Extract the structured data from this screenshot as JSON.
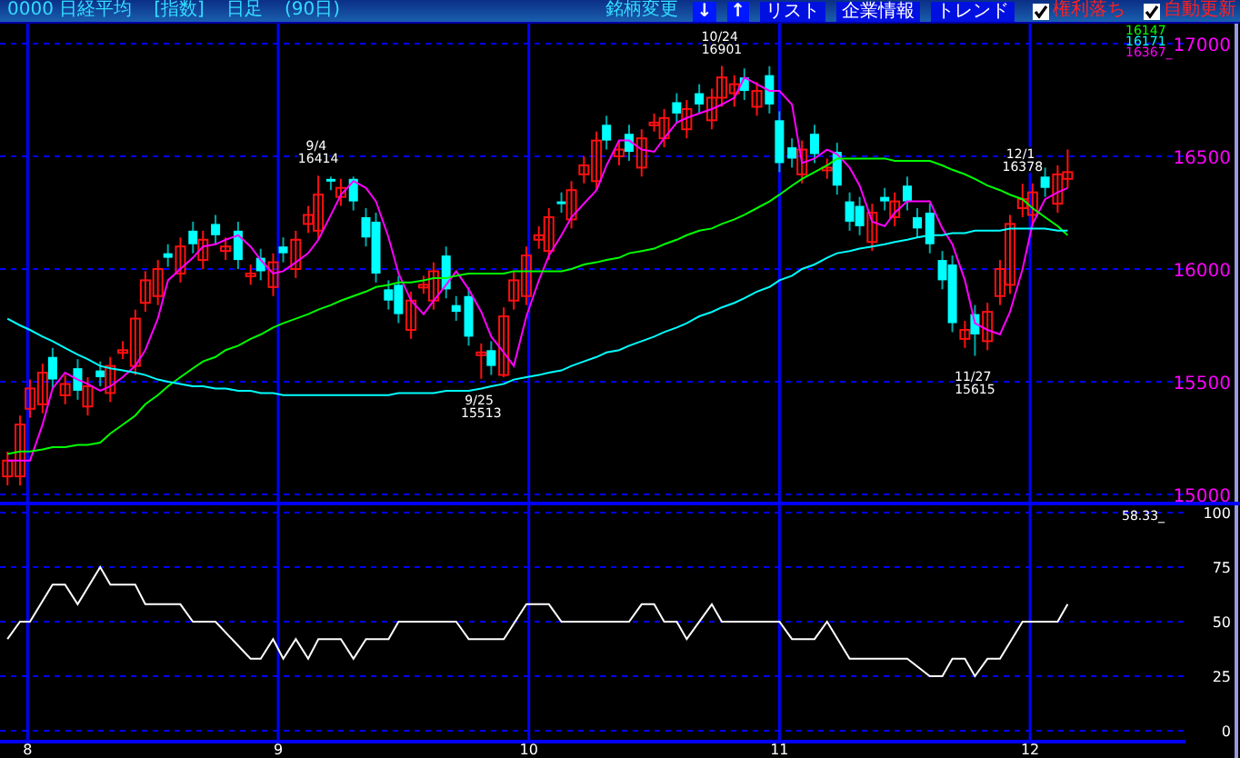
{
  "header": {
    "code": "0000",
    "name": "日経平均",
    "type": "[指数]",
    "period": "日足",
    "span": "(90日)"
  },
  "toolbar": {
    "label": "銘柄変更",
    "buttons": [
      {
        "kind": "arrow",
        "label": "↓"
      },
      {
        "kind": "arrow",
        "label": "↑"
      },
      {
        "kind": "text",
        "label": "リスト"
      },
      {
        "kind": "text",
        "label": "企業情報"
      },
      {
        "kind": "text",
        "label": "トレンド"
      }
    ],
    "options": [
      {
        "label": "権利落ち",
        "checked": true
      },
      {
        "label": "自動更新",
        "checked": true
      }
    ]
  },
  "price_chart": {
    "ma_values": [
      {
        "text": "16147",
        "color": "#00ff00"
      },
      {
        "text": "16171",
        "color": "#00ffff"
      },
      {
        "text": "16367_",
        "color": "#ff00ff"
      }
    ],
    "chart_data": {
      "type": "candlestick",
      "xlim": [
        7.89,
        12.62
      ],
      "ylim": [
        15000,
        17000
      ],
      "yticks": [
        15000,
        15500,
        16000,
        16500,
        17000
      ],
      "grid": true,
      "x": [
        7.92,
        7.97,
        8.01,
        8.06,
        8.1,
        8.15,
        8.2,
        8.24,
        8.29,
        8.33,
        8.38,
        8.43,
        8.47,
        8.52,
        8.56,
        8.61,
        8.66,
        8.7,
        8.75,
        8.79,
        8.84,
        8.89,
        8.93,
        8.98,
        9.02,
        9.07,
        9.12,
        9.16,
        9.21,
        9.25,
        9.3,
        9.35,
        9.39,
        9.44,
        9.48,
        9.53,
        9.58,
        9.62,
        9.67,
        9.71,
        9.76,
        9.81,
        9.85,
        9.9,
        9.94,
        9.99,
        10.04,
        10.08,
        10.13,
        10.17,
        10.22,
        10.27,
        10.31,
        10.36,
        10.4,
        10.45,
        10.5,
        10.54,
        10.59,
        10.63,
        10.68,
        10.73,
        10.77,
        10.82,
        10.86,
        10.91,
        10.96,
        11,
        11.05,
        11.09,
        11.14,
        11.19,
        11.23,
        11.28,
        11.32,
        11.37,
        11.42,
        11.46,
        11.51,
        11.55,
        11.6,
        11.65,
        11.69,
        11.74,
        11.78,
        11.83,
        11.88,
        11.92,
        11.97,
        12.01,
        12.06,
        12.11,
        12.15
      ],
      "ohlc": [
        [
          15080,
          15190,
          15040,
          15150
        ],
        [
          15080,
          15350,
          15040,
          15310
        ],
        [
          15380,
          15510,
          15340,
          15470
        ],
        [
          15400,
          15580,
          15360,
          15540
        ],
        [
          15610,
          15650,
          15470,
          15510
        ],
        [
          15440,
          15530,
          15400,
          15490
        ],
        [
          15560,
          15600,
          15420,
          15460
        ],
        [
          15390,
          15520,
          15350,
          15480
        ],
        [
          15550,
          15590,
          15480,
          15520
        ],
        [
          15450,
          15610,
          15410,
          15570
        ],
        [
          15640,
          15680,
          15600,
          15640
        ],
        [
          15570,
          15820,
          15530,
          15780
        ],
        [
          15850,
          15990,
          15810,
          15950
        ],
        [
          15880,
          16040,
          15840,
          16000
        ],
        [
          16070,
          16110,
          16010,
          16050
        ],
        [
          15980,
          16140,
          15940,
          16100
        ],
        [
          16170,
          16210,
          16070,
          16110
        ],
        [
          16040,
          16170,
          16000,
          16130
        ],
        [
          16200,
          16240,
          16110,
          16150
        ],
        [
          16080,
          16140,
          16040,
          16100
        ],
        [
          16170,
          16210,
          16000,
          16040
        ],
        [
          15970,
          16020,
          15930,
          15980
        ],
        [
          16050,
          16090,
          15950,
          15990
        ],
        [
          15920,
          16070,
          15880,
          16030
        ],
        [
          16100,
          16140,
          16030,
          16070
        ],
        [
          16000,
          16170,
          15960,
          16130
        ],
        [
          16200,
          16280,
          16160,
          16240
        ],
        [
          16170,
          16414,
          16130,
          16330
        ],
        [
          16400,
          16410,
          16350,
          16390
        ],
        [
          16320,
          16400,
          16280,
          16360
        ],
        [
          16400,
          16410,
          16260,
          16300
        ],
        [
          16230,
          16270,
          16100,
          16140
        ],
        [
          16210,
          16250,
          15940,
          15980
        ],
        [
          15910,
          15950,
          15820,
          15860
        ],
        [
          15930,
          15970,
          15760,
          15800
        ],
        [
          15730,
          15900,
          15690,
          15860
        ],
        [
          15930,
          15970,
          15890,
          15930
        ],
        [
          15860,
          16030,
          15820,
          15990
        ],
        [
          16060,
          16100,
          15870,
          15910
        ],
        [
          15840,
          15880,
          15770,
          15810
        ],
        [
          15880,
          15920,
          15660,
          15700
        ],
        [
          15630,
          15670,
          15513,
          15630
        ],
        [
          15640,
          15680,
          15530,
          15570
        ],
        [
          15530,
          15830,
          15520,
          15790
        ],
        [
          15860,
          15990,
          15820,
          15950
        ],
        [
          15880,
          16100,
          15840,
          16060
        ],
        [
          16130,
          16190,
          16090,
          16150
        ],
        [
          16080,
          16270,
          16040,
          16230
        ],
        [
          16300,
          16340,
          16250,
          16290
        ],
        [
          16220,
          16390,
          16180,
          16350
        ],
        [
          16420,
          16500,
          16380,
          16460
        ],
        [
          16390,
          16610,
          16350,
          16570
        ],
        [
          16640,
          16680,
          16530,
          16570
        ],
        [
          16500,
          16570,
          16460,
          16530
        ],
        [
          16600,
          16640,
          16480,
          16520
        ],
        [
          16450,
          16620,
          16410,
          16580
        ],
        [
          16650,
          16690,
          16610,
          16650
        ],
        [
          16580,
          16710,
          16540,
          16670
        ],
        [
          16740,
          16780,
          16650,
          16690
        ],
        [
          16620,
          16750,
          16580,
          16710
        ],
        [
          16780,
          16820,
          16690,
          16730
        ],
        [
          16660,
          16800,
          16620,
          16760
        ],
        [
          16760,
          16901,
          16720,
          16850
        ],
        [
          16780,
          16860,
          16720,
          16820
        ],
        [
          16850,
          16890,
          16750,
          16790
        ],
        [
          16720,
          16830,
          16680,
          16790
        ],
        [
          16860,
          16900,
          16690,
          16730
        ],
        [
          16660,
          16700,
          16430,
          16470
        ],
        [
          16540,
          16580,
          16450,
          16490
        ],
        [
          16420,
          16570,
          16380,
          16530
        ],
        [
          16600,
          16640,
          16470,
          16510
        ],
        [
          16440,
          16490,
          16400,
          16450
        ],
        [
          16520,
          16560,
          16330,
          16370
        ],
        [
          16300,
          16340,
          16170,
          16210
        ],
        [
          16280,
          16320,
          16150,
          16190
        ],
        [
          16120,
          16290,
          16080,
          16250
        ],
        [
          16320,
          16360,
          16260,
          16300
        ],
        [
          16230,
          16340,
          16190,
          16300
        ],
        [
          16370,
          16410,
          16260,
          16300
        ],
        [
          16230,
          16270,
          16140,
          16180
        ],
        [
          16250,
          16290,
          16070,
          16110
        ],
        [
          16040,
          16080,
          15910,
          15950
        ],
        [
          16020,
          16060,
          15720,
          15760
        ],
        [
          15690,
          15770,
          15650,
          15730
        ],
        [
          15800,
          15840,
          15615,
          15710
        ],
        [
          15680,
          15850,
          15640,
          15810
        ],
        [
          15880,
          16040,
          15840,
          16000
        ],
        [
          15930,
          16240,
          15890,
          16200
        ],
        [
          16270,
          16378,
          16230,
          16310
        ],
        [
          16240,
          16380,
          16200,
          16340
        ],
        [
          16410,
          16450,
          16320,
          16360
        ],
        [
          16290,
          16460,
          16250,
          16420
        ],
        [
          16400,
          16530,
          16360,
          16430
        ]
      ],
      "annotations": [
        {
          "x": 9.16,
          "y": 16414,
          "text": "9/4 16414"
        },
        {
          "x": 10.77,
          "y": 16901,
          "text": "10/24 16901"
        },
        {
          "x": 9.81,
          "y": 15513,
          "text": "9/25 15513"
        },
        {
          "x": 11.78,
          "y": 15615,
          "text": "11/27 15615"
        },
        {
          "x": 11.97,
          "y": 16378,
          "text": "12/1 16378"
        }
      ]
    },
    "moving_averages": {
      "chart_data": {
        "type": "line",
        "xlim": [
          7.89,
          12.62
        ],
        "ylim": [
          15000,
          17000
        ],
        "x": [
          7.92,
          7.97,
          8.01,
          8.06,
          8.1,
          8.15,
          8.2,
          8.24,
          8.29,
          8.33,
          8.38,
          8.43,
          8.47,
          8.52,
          8.56,
          8.61,
          8.66,
          8.7,
          8.75,
          8.79,
          8.84,
          8.89,
          8.93,
          8.98,
          9.02,
          9.07,
          9.12,
          9.16,
          9.21,
          9.25,
          9.3,
          9.35,
          9.39,
          9.44,
          9.48,
          9.53,
          9.58,
          9.62,
          9.67,
          9.71,
          9.76,
          9.81,
          9.85,
          9.9,
          9.94,
          9.99,
          10.04,
          10.08,
          10.13,
          10.17,
          10.22,
          10.27,
          10.31,
          10.36,
          10.4,
          10.45,
          10.5,
          10.54,
          10.59,
          10.63,
          10.68,
          10.73,
          10.77,
          10.82,
          10.86,
          10.91,
          10.96,
          11,
          11.05,
          11.09,
          11.14,
          11.19,
          11.23,
          11.28,
          11.32,
          11.37,
          11.42,
          11.46,
          11.51,
          11.55,
          11.6,
          11.65,
          11.69,
          11.74,
          11.78,
          11.83,
          11.88,
          11.92,
          11.97,
          12.01,
          12.06,
          12.11,
          12.15
        ],
        "series": [
          {
            "color": "#ff00ff",
            "values": [
              15150,
              15150,
              15150,
              15310,
              15470,
              15540,
              15510,
              15490,
              15460,
              15480,
              15520,
              15570,
              15640,
              15780,
              15950,
              16000,
              16050,
              16100,
              16110,
              16130,
              16150,
              16100,
              16040,
              15980,
              15990,
              16030,
              16070,
              16130,
              16240,
              16330,
              16390,
              16360,
              16300,
              16140,
              15980,
              15860,
              15800,
              15860,
              15930,
              15990,
              15910,
              15810,
              15700,
              15630,
              15570,
              15790,
              15950,
              16060,
              16150,
              16230,
              16290,
              16350,
              16460,
              16570,
              16570,
              16530,
              16520,
              16580,
              16650,
              16670,
              16690,
              16710,
              16730,
              16760,
              16850,
              16820,
              16790,
              16790,
              16730,
              16470,
              16490,
              16530,
              16510,
              16450,
              16370,
              16210,
              16190,
              16250,
              16300,
              16300,
              16300,
              16180,
              16110,
              15950,
              15760,
              15730,
              15710,
              15810,
              16000,
              16200,
              16310,
              16340,
              16360
            ]
          },
          {
            "color": "#00ff00",
            "values": [
              15180,
              15190,
              15190,
              15200,
              15210,
              15210,
              15220,
              15220,
              15230,
              15270,
              15310,
              15350,
              15400,
              15440,
              15480,
              15520,
              15560,
              15590,
              15610,
              15640,
              15660,
              15690,
              15710,
              15740,
              15760,
              15780,
              15800,
              15820,
              15840,
              15860,
              15880,
              15900,
              15920,
              15930,
              15940,
              15940,
              15950,
              15960,
              15960,
              15970,
              15980,
              15980,
              15980,
              15980,
              15990,
              15990,
              15990,
              15990,
              15990,
              16000,
              16020,
              16030,
              16040,
              16050,
              16070,
              16080,
              16090,
              16110,
              16130,
              16150,
              16170,
              16180,
              16200,
              16220,
              16240,
              16270,
              16300,
              16330,
              16370,
              16400,
              16430,
              16460,
              16490,
              16490,
              16490,
              16490,
              16490,
              16480,
              16480,
              16480,
              16480,
              16460,
              16440,
              16420,
              16400,
              16370,
              16350,
              16330,
              16310,
              16270,
              16230,
              16190,
              16150
            ]
          },
          {
            "color": "#00ffff",
            "values": [
              15780,
              15750,
              15730,
              15700,
              15680,
              15650,
              15620,
              15600,
              15570,
              15560,
              15550,
              15540,
              15530,
              15510,
              15500,
              15490,
              15480,
              15480,
              15470,
              15470,
              15460,
              15460,
              15450,
              15450,
              15440,
              15440,
              15440,
              15440,
              15440,
              15440,
              15440,
              15440,
              15440,
              15440,
              15450,
              15450,
              15450,
              15450,
              15460,
              15460,
              15460,
              15470,
              15480,
              15490,
              15510,
              15520,
              15530,
              15540,
              15550,
              15570,
              15590,
              15610,
              15630,
              15640,
              15660,
              15680,
              15700,
              15720,
              15740,
              15760,
              15790,
              15810,
              15830,
              15850,
              15870,
              15900,
              15920,
              15950,
              15970,
              16000,
              16020,
              16050,
              16070,
              16080,
              16090,
              16100,
              16110,
              16120,
              16130,
              16140,
              16150,
              16150,
              16160,
              16160,
              16170,
              16170,
              16170,
              16180,
              16180,
              16180,
              16180,
              16170,
              16170
            ]
          }
        ]
      }
    }
  },
  "oscillator": {
    "current_value": "58.33_",
    "chart_data": {
      "type": "line",
      "xlim": [
        7.89,
        12.62
      ],
      "ylim": [
        0,
        100
      ],
      "yticks": [
        0,
        25,
        50,
        75,
        100
      ],
      "xticks": [
        8,
        9,
        10,
        11,
        12
      ],
      "grid": true,
      "x": [
        7.92,
        7.97,
        8.01,
        8.1,
        8.15,
        8.2,
        8.29,
        8.33,
        8.43,
        8.47,
        8.61,
        8.66,
        8.75,
        8.89,
        8.93,
        8.98,
        9.02,
        9.07,
        9.12,
        9.16,
        9.25,
        9.3,
        9.35,
        9.44,
        9.48,
        9.71,
        9.76,
        9.9,
        9.99,
        10.08,
        10.13,
        10.4,
        10.45,
        10.5,
        10.54,
        10.59,
        10.63,
        10.73,
        10.77,
        11,
        11.05,
        11.14,
        11.19,
        11.28,
        11.51,
        11.6,
        11.65,
        11.69,
        11.74,
        11.78,
        11.83,
        11.88,
        11.97,
        12.11,
        12.15
      ],
      "series": [
        {
          "color": "#ffffff",
          "values": [
            42,
            50,
            50,
            67,
            67,
            58,
            75,
            67,
            67,
            58,
            58,
            50,
            50,
            33,
            33,
            42,
            33,
            42,
            33,
            42,
            42,
            33,
            42,
            42,
            50,
            50,
            42,
            42,
            58,
            58,
            50,
            50,
            58,
            58,
            50,
            50,
            42,
            58,
            50,
            50,
            42,
            42,
            50,
            33,
            33,
            25,
            25,
            33,
            33,
            25,
            33,
            33,
            50,
            50,
            58
          ]
        }
      ]
    }
  }
}
